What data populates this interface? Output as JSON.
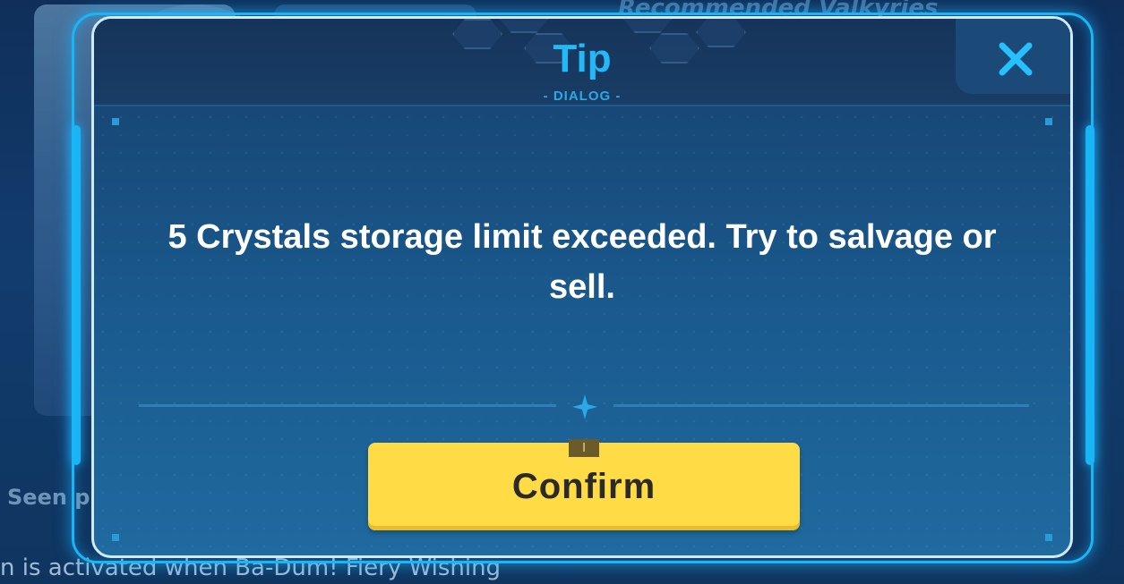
{
  "background": {
    "top_text": "Recommended Valkyries",
    "seen_text": "Seen p",
    "bottom_text": "n is activated when Ba-Dum! Fiery Wishing"
  },
  "dialog": {
    "title": "Tip",
    "subtitle": "- DIALOG -",
    "message_count": "5",
    "message_text": " Crystals storage limit exceeded. Try to salvage or sell.",
    "confirm_label": "Confirm",
    "confirm_notch": "I"
  },
  "icons": {
    "close": "close-icon",
    "divider": "sparkle-icon"
  },
  "colors": {
    "accent": "#23b8f6",
    "button": "#ffdc46",
    "button_text": "#2b2a26",
    "message_text": "#ffffff"
  }
}
